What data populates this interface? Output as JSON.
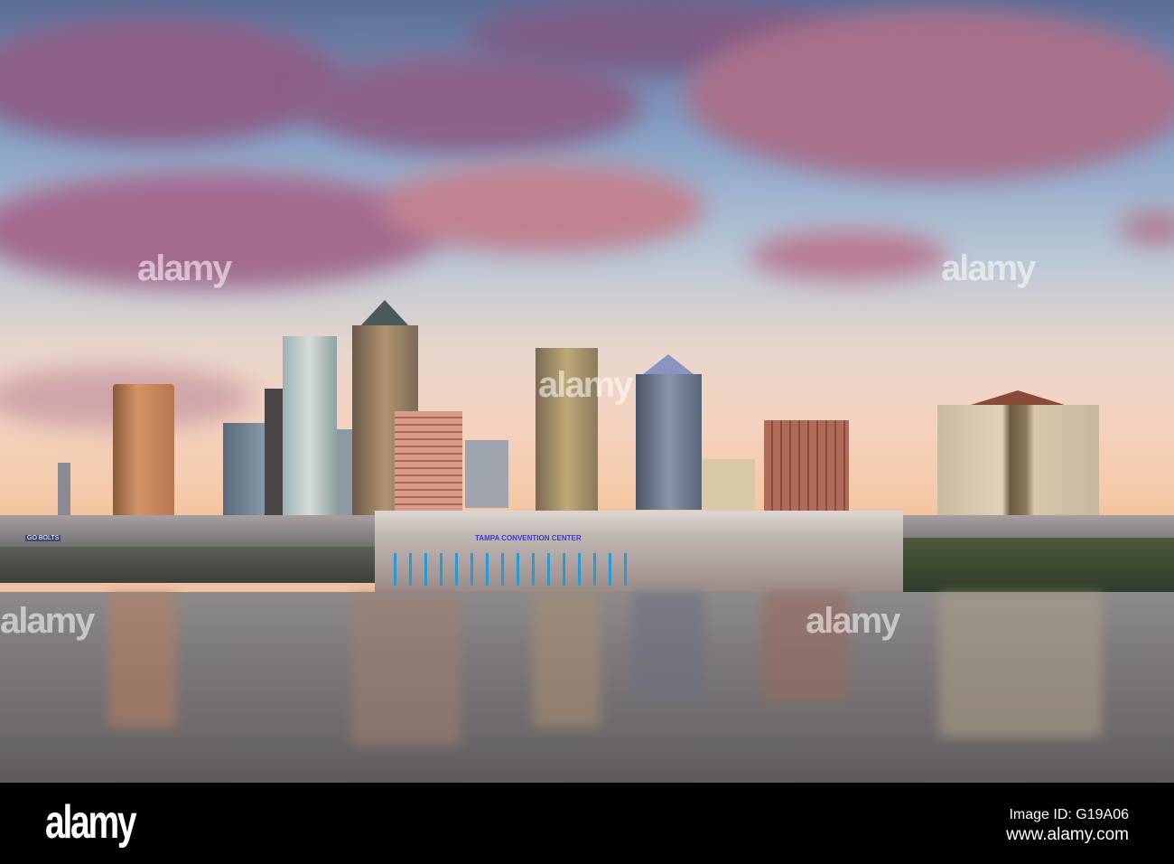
{
  "photo": {
    "sign": "TAMPA CONVENTION CENTER",
    "billboard": "GO BOLTS"
  },
  "watermark": "alamy",
  "footer": {
    "logo": "alamy",
    "image_id": "Image ID: G19A06",
    "url": "www.alamy.com"
  }
}
